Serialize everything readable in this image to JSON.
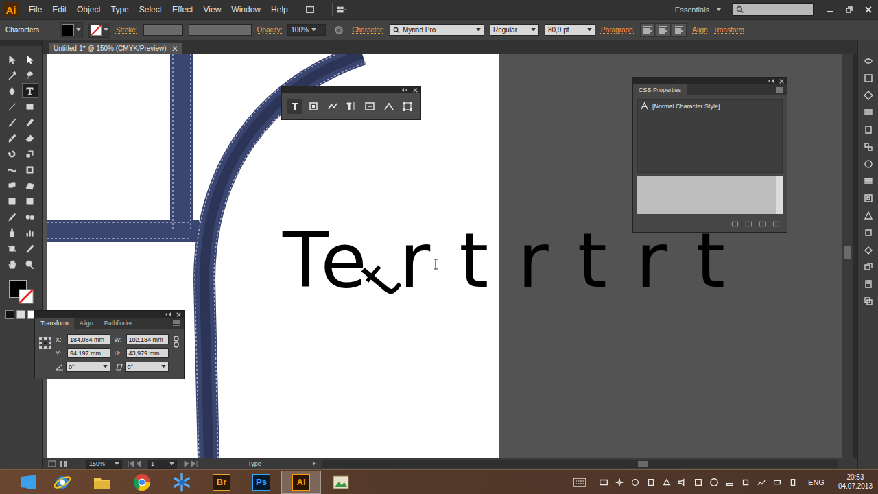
{
  "app": {
    "logo": "Ai"
  },
  "menu": [
    "File",
    "Edit",
    "Object",
    "Type",
    "Select",
    "Effect",
    "View",
    "Window",
    "Help"
  ],
  "workspace": {
    "label": "Essentials"
  },
  "control_bar": {
    "mode": "Characters",
    "stroke_label": "Stroke:",
    "opacity_label": "Opacity:",
    "opacity": "100%",
    "character_label": "Character:",
    "font": "Myriad Pro",
    "font_style": "Regular",
    "font_size": "80,9 pt",
    "paragraph_label": "Paragraph:",
    "links": [
      "Align",
      "Transform"
    ]
  },
  "document_tab": {
    "title": "Untitled-1* @ 150% (CMYK/Preview)"
  },
  "tools": [
    {
      "kind": "selection",
      "selected": false
    },
    {
      "kind": "direct-selection",
      "selected": false
    },
    {
      "kind": "magic-wand",
      "selected": false
    },
    {
      "kind": "lasso",
      "selected": false
    },
    {
      "kind": "pen",
      "selected": false
    },
    {
      "kind": "type",
      "selected": true
    },
    {
      "kind": "line",
      "selected": false
    },
    {
      "kind": "rectangle",
      "selected": false
    },
    {
      "kind": "paintbrush",
      "selected": false
    },
    {
      "kind": "pencil",
      "selected": false
    },
    {
      "kind": "blob-brush",
      "selected": false
    },
    {
      "kind": "eraser",
      "selected": false
    },
    {
      "kind": "rotate",
      "selected": false
    },
    {
      "kind": "scale",
      "selected": false
    },
    {
      "kind": "width",
      "selected": false
    },
    {
      "kind": "free-transform",
      "selected": false
    },
    {
      "kind": "shape-builder",
      "selected": false
    },
    {
      "kind": "perspective",
      "selected": false
    },
    {
      "kind": "mesh",
      "selected": false
    },
    {
      "kind": "gradient",
      "selected": false
    },
    {
      "kind": "eyedropper",
      "selected": false
    },
    {
      "kind": "blend",
      "selected": false
    },
    {
      "kind": "symbol-sprayer",
      "selected": false
    },
    {
      "kind": "graph",
      "selected": false
    },
    {
      "kind": "artboard",
      "selected": false
    },
    {
      "kind": "slice",
      "selected": false
    },
    {
      "kind": "hand",
      "selected": false
    },
    {
      "kind": "zoom",
      "selected": false
    }
  ],
  "canvas": {
    "glyphs": [
      "T",
      "e",
      "t",
      "r",
      "t",
      "r",
      "t",
      "r",
      "t"
    ]
  },
  "css_properties": {
    "title": "CSS Properties",
    "styles": [
      {
        "label": "[Normal Character Style]",
        "selected": false
      }
    ]
  },
  "transform_panel": {
    "tabs": [
      {
        "label": "Transform",
        "selected": true
      },
      {
        "label": "Align",
        "selected": false
      },
      {
        "label": "Pathfinder",
        "selected": false
      }
    ],
    "fields": [
      {
        "label": "X:",
        "value": "184,084 mm"
      },
      {
        "label": "W:",
        "value": "102,184 mm"
      },
      {
        "label": "Y:",
        "value": "94,197 mm"
      },
      {
        "label": "H:",
        "value": "43,979 mm"
      }
    ],
    "angles": [
      {
        "kind": "rotate",
        "value": "0°"
      },
      {
        "kind": "shear",
        "value": "0°"
      }
    ]
  },
  "status_bar": {
    "zoom": "150%",
    "page": "1",
    "tool": "Type"
  },
  "taskbar": {
    "apps": [
      {
        "kind": "ie",
        "label": "",
        "selected": false
      },
      {
        "kind": "explorer",
        "label": "",
        "selected": false
      },
      {
        "kind": "chrome",
        "label": "",
        "selected": false
      },
      {
        "kind": "snowflake",
        "label": "",
        "selected": false
      },
      {
        "kind": "bridge",
        "label": "Br",
        "selected": false
      },
      {
        "kind": "photoshop",
        "label": "Ps",
        "selected": false
      },
      {
        "kind": "illustrator",
        "label": "Ai",
        "selected": true
      },
      {
        "kind": "picture",
        "label": "",
        "selected": false
      }
    ]
  },
  "tray": {
    "language": "ENG",
    "time": "20:53",
    "date": "04.07.2013"
  }
}
